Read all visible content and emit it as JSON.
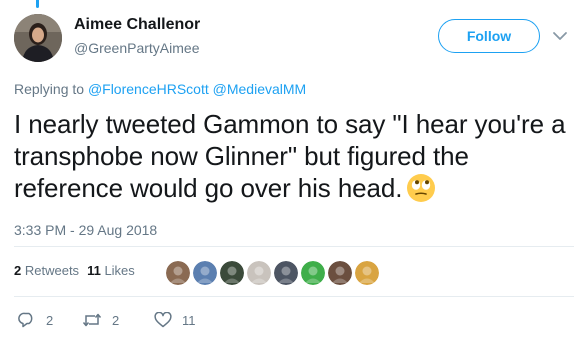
{
  "author": {
    "display_name": "Aimee Challenor",
    "handle": "@GreenPartyAimee"
  },
  "follow_button": {
    "label": "Follow"
  },
  "reply": {
    "prefix": "Replying to",
    "mentions": [
      "@FlorenceHRScott",
      "@MedievalMM"
    ]
  },
  "tweet": {
    "text": "I nearly tweeted Gammon to say \"I hear you're a transphobe now Glinner\" but figured the reference would go over his head.",
    "emoji": "face-with-rolling-eyes"
  },
  "timestamp": "3:33 PM - 29 Aug 2018",
  "stats": {
    "retweets_count": "2",
    "retweets_label": "Retweets",
    "likes_count": "11",
    "likes_label": "Likes"
  },
  "likers": [
    {
      "icon": "liker-avatar-1",
      "color": "#8a6a52"
    },
    {
      "icon": "liker-avatar-2",
      "color": "#5b7fb0"
    },
    {
      "icon": "liker-avatar-3",
      "color": "#3b4a3a"
    },
    {
      "icon": "liker-avatar-4",
      "color": "#c9c3bd"
    },
    {
      "icon": "liker-avatar-5",
      "color": "#4d5563"
    },
    {
      "icon": "liker-avatar-6",
      "color": "#3fae4a"
    },
    {
      "icon": "liker-avatar-7",
      "color": "#6b4f3f"
    },
    {
      "icon": "liker-avatar-8",
      "color": "#d9a441"
    }
  ],
  "actions": {
    "replies": "2",
    "retweets": "2",
    "likes": "11"
  },
  "colors": {
    "accent": "#1da1f2",
    "text": "#14171a",
    "muted": "#657786",
    "divider": "#e6ecf0"
  }
}
